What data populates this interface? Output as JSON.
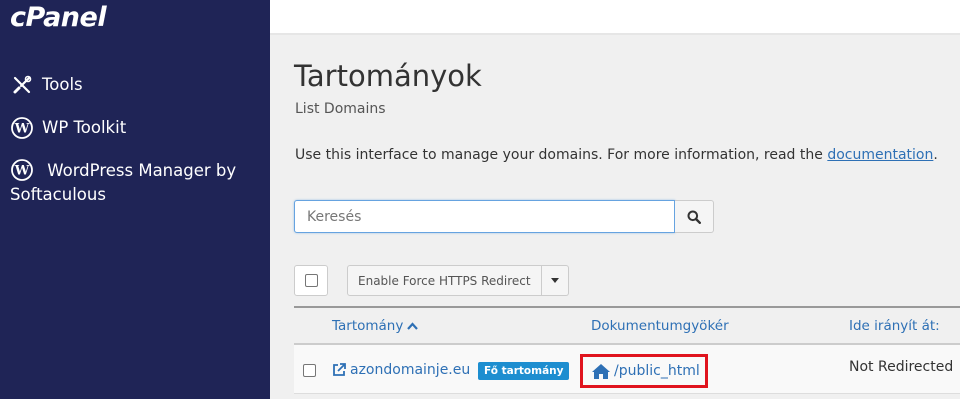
{
  "sidebar": {
    "logo": "cPanel",
    "items": [
      {
        "label": "Tools",
        "icon": "tools-icon"
      },
      {
        "label": "WP Toolkit",
        "icon": "wordpress-icon"
      },
      {
        "label": "WordPress Manager by Softaculous",
        "icon": "wordpress-icon"
      }
    ]
  },
  "page": {
    "title": "Tartományok",
    "subtitle": "List Domains",
    "intro_text": "Use this interface to manage your domains. For more information, read the ",
    "intro_link": "documentation",
    "intro_end": "."
  },
  "search": {
    "placeholder": "Keresés",
    "value": ""
  },
  "toolbar": {
    "https_label": "Enable Force HTTPS Redirect"
  },
  "table": {
    "columns": [
      "Tartomány",
      "Dokumentumgyökér",
      "Ide irányít át:"
    ],
    "rows": [
      {
        "domain": "azondomainje.eu",
        "badge": "Fő tartomány",
        "docroot": "/public_html",
        "redirect": "Not Redirected"
      }
    ]
  },
  "colors": {
    "sidebar_bg": "#1f2456",
    "link": "#2e70b5",
    "badge": "#1d8ed0",
    "highlight": "#e0141e"
  }
}
